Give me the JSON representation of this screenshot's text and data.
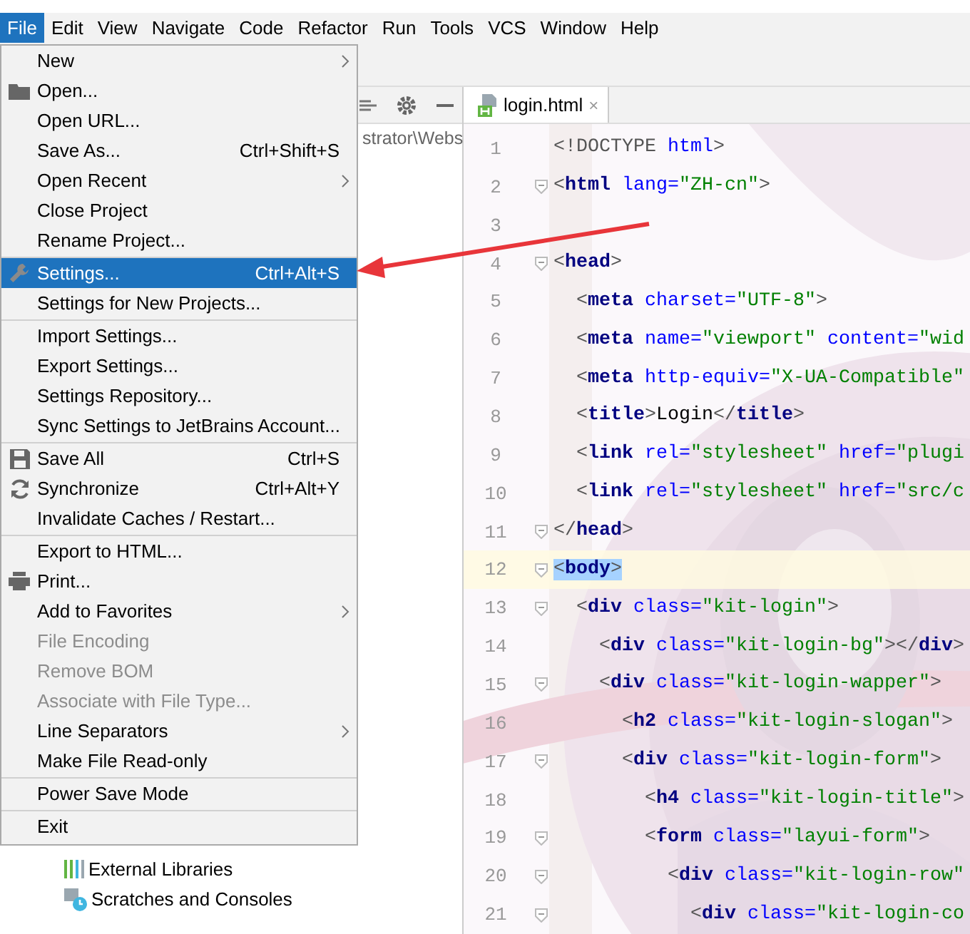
{
  "menu_bar": [
    {
      "label": "File",
      "selected": true
    },
    {
      "label": "Edit",
      "selected": false
    },
    {
      "label": "View",
      "selected": false
    },
    {
      "label": "Navigate",
      "selected": false
    },
    {
      "label": "Code",
      "selected": false
    },
    {
      "label": "Refactor",
      "selected": false
    },
    {
      "label": "Run",
      "selected": false
    },
    {
      "label": "Tools",
      "selected": false
    },
    {
      "label": "VCS",
      "selected": false
    },
    {
      "label": "Window",
      "selected": false
    },
    {
      "label": "Help",
      "selected": false
    }
  ],
  "file_menu": [
    {
      "kind": "item",
      "label": "New",
      "submenu": true,
      "disabled": false,
      "selected": false
    },
    {
      "kind": "folder",
      "label": "Open...",
      "disabled": false,
      "selected": false
    },
    {
      "kind": "item",
      "label": "Open URL...",
      "disabled": false,
      "selected": false
    },
    {
      "kind": "item",
      "label": "Save As...",
      "shortcut": "Ctrl+Shift+S",
      "disabled": false,
      "selected": false
    },
    {
      "kind": "item",
      "label": "Open Recent",
      "submenu": true,
      "disabled": false,
      "selected": false
    },
    {
      "kind": "item",
      "label": "Close Project",
      "disabled": false,
      "selected": false
    },
    {
      "kind": "item",
      "label": "Rename Project...",
      "disabled": false,
      "selected": false
    },
    {
      "kind": "separator"
    },
    {
      "kind": "wrench",
      "label": "Settings...",
      "shortcut": "Ctrl+Alt+S",
      "disabled": false,
      "selected": true
    },
    {
      "kind": "item",
      "label": "Settings for New Projects...",
      "disabled": false,
      "selected": false
    },
    {
      "kind": "separator"
    },
    {
      "kind": "item",
      "label": "Import Settings...",
      "disabled": false,
      "selected": false
    },
    {
      "kind": "item",
      "label": "Export Settings...",
      "disabled": false,
      "selected": false
    },
    {
      "kind": "item",
      "label": "Settings Repository...",
      "disabled": false,
      "selected": false
    },
    {
      "kind": "item",
      "label": "Sync Settings to JetBrains Account...",
      "disabled": false,
      "selected": false
    },
    {
      "kind": "separator"
    },
    {
      "kind": "save",
      "label": "Save All",
      "shortcut": "Ctrl+S",
      "disabled": false,
      "selected": false
    },
    {
      "kind": "sync",
      "label": "Synchronize",
      "shortcut": "Ctrl+Alt+Y",
      "disabled": false,
      "selected": false
    },
    {
      "kind": "item",
      "label": "Invalidate Caches / Restart...",
      "disabled": false,
      "selected": false
    },
    {
      "kind": "separator"
    },
    {
      "kind": "item",
      "label": "Export to HTML...",
      "disabled": false,
      "selected": false
    },
    {
      "kind": "printer",
      "label": "Print...",
      "disabled": false,
      "selected": false
    },
    {
      "kind": "item",
      "label": "Add to Favorites",
      "submenu": true,
      "disabled": false,
      "selected": false
    },
    {
      "kind": "item",
      "label": "File Encoding",
      "disabled": true,
      "selected": false
    },
    {
      "kind": "item",
      "label": "Remove BOM",
      "disabled": true,
      "selected": false
    },
    {
      "kind": "item",
      "label": "Associate with File Type...",
      "disabled": true,
      "selected": false
    },
    {
      "kind": "item",
      "label": "Line Separators",
      "submenu": true,
      "disabled": false,
      "selected": false
    },
    {
      "kind": "item",
      "label": "Make File Read-only",
      "disabled": false,
      "selected": false
    },
    {
      "kind": "separator"
    },
    {
      "kind": "item",
      "label": "Power Save Mode",
      "disabled": false,
      "selected": false
    },
    {
      "kind": "separator"
    },
    {
      "kind": "item",
      "label": "Exit",
      "disabled": false,
      "selected": false
    }
  ],
  "project_panel": {
    "path": "strator\\Webs",
    "tree": [
      {
        "kind": "libraries",
        "label": "External Libraries"
      },
      {
        "kind": "scratches",
        "label": "Scratches and Consoles"
      }
    ]
  },
  "editor": {
    "tabs": [
      {
        "label": "login.html",
        "close": "×",
        "selected": true
      }
    ],
    "lines": [
      {
        "number": "1",
        "fold": false,
        "current": false,
        "tokens": [
          {
            "kind": "punct",
            "text": "<!DOCTYPE "
          },
          {
            "kind": "attr",
            "text": "html"
          },
          {
            "kind": "punct",
            "text": ">"
          }
        ]
      },
      {
        "number": "2",
        "fold": true,
        "current": false,
        "tokens": [
          {
            "kind": "punct",
            "text": "<"
          },
          {
            "kind": "tag",
            "text": "html"
          },
          {
            "kind": "attr",
            "text": " lang="
          },
          {
            "kind": "value",
            "text": "\"ZH-cn\""
          },
          {
            "kind": "punct",
            "text": ">"
          }
        ]
      },
      {
        "number": "3",
        "fold": false,
        "current": false
      },
      {
        "number": "4",
        "fold": true,
        "current": false,
        "tokens": [
          {
            "kind": "punct",
            "text": "<"
          },
          {
            "kind": "tag",
            "text": "head"
          },
          {
            "kind": "punct",
            "text": ">"
          }
        ]
      },
      {
        "number": "5",
        "fold": false,
        "current": false,
        "tokens": [
          {
            "kind": "punct",
            "text": "  <"
          },
          {
            "kind": "tag",
            "text": "meta"
          },
          {
            "kind": "attr",
            "text": " charset="
          },
          {
            "kind": "value",
            "text": "\"UTF-8\""
          },
          {
            "kind": "punct",
            "text": ">"
          }
        ]
      },
      {
        "number": "6",
        "fold": false,
        "current": false,
        "tokens": [
          {
            "kind": "punct",
            "text": "  <"
          },
          {
            "kind": "tag",
            "text": "meta"
          },
          {
            "kind": "attr",
            "text": " name="
          },
          {
            "kind": "value",
            "text": "\"viewport\""
          },
          {
            "kind": "attr",
            "text": " content="
          },
          {
            "kind": "value",
            "text": "\"wid"
          }
        ]
      },
      {
        "number": "7",
        "fold": false,
        "current": false,
        "tokens": [
          {
            "kind": "punct",
            "text": "  <"
          },
          {
            "kind": "tag",
            "text": "meta"
          },
          {
            "kind": "attr",
            "text": " http-equiv="
          },
          {
            "kind": "value",
            "text": "\"X-UA-Compatible\""
          }
        ]
      },
      {
        "number": "8",
        "fold": false,
        "current": false,
        "tokens": [
          {
            "kind": "punct",
            "text": "  <"
          },
          {
            "kind": "tag",
            "text": "title"
          },
          {
            "kind": "punct",
            "text": ">"
          },
          {
            "kind": "text",
            "text": "Login"
          },
          {
            "kind": "punct",
            "text": "</"
          },
          {
            "kind": "tag",
            "text": "title"
          },
          {
            "kind": "punct",
            "text": ">"
          }
        ]
      },
      {
        "number": "9",
        "fold": false,
        "current": false,
        "tokens": [
          {
            "kind": "punct",
            "text": "  <"
          },
          {
            "kind": "tag",
            "text": "link"
          },
          {
            "kind": "attr",
            "text": " rel="
          },
          {
            "kind": "value",
            "text": "\"stylesheet\""
          },
          {
            "kind": "attr",
            "text": " href="
          },
          {
            "kind": "value",
            "text": "\"plugi"
          }
        ]
      },
      {
        "number": "10",
        "fold": false,
        "current": false,
        "tokens": [
          {
            "kind": "punct",
            "text": "  <"
          },
          {
            "kind": "tag",
            "text": "link"
          },
          {
            "kind": "attr",
            "text": " rel="
          },
          {
            "kind": "value",
            "text": "\"stylesheet\""
          },
          {
            "kind": "attr",
            "text": " href="
          },
          {
            "kind": "value",
            "text": "\"src/c"
          }
        ]
      },
      {
        "number": "11",
        "fold": true,
        "current": false,
        "tokens": [
          {
            "kind": "punct",
            "text": "</"
          },
          {
            "kind": "tag",
            "text": "head"
          },
          {
            "kind": "punct",
            "text": ">"
          }
        ]
      },
      {
        "number": "12",
        "fold": true,
        "current": true,
        "tokens": [
          {
            "kind": "punct",
            "text": "<",
            "marked": true
          },
          {
            "kind": "tag",
            "text": "body",
            "marked": true
          },
          {
            "kind": "punct",
            "text": ">",
            "marked": true
          }
        ]
      },
      {
        "number": "13",
        "fold": true,
        "current": false,
        "tokens": [
          {
            "kind": "punct",
            "text": "  <"
          },
          {
            "kind": "tag",
            "text": "div"
          },
          {
            "kind": "attr",
            "text": " class="
          },
          {
            "kind": "value",
            "text": "\"kit-login\""
          },
          {
            "kind": "punct",
            "text": ">"
          }
        ]
      },
      {
        "number": "14",
        "fold": false,
        "current": false,
        "tokens": [
          {
            "kind": "punct",
            "text": "    <"
          },
          {
            "kind": "tag",
            "text": "div"
          },
          {
            "kind": "attr",
            "text": " class="
          },
          {
            "kind": "value",
            "text": "\"kit-login-bg\""
          },
          {
            "kind": "punct",
            "text": "></"
          },
          {
            "kind": "tag",
            "text": "div"
          },
          {
            "kind": "punct",
            "text": ">"
          }
        ]
      },
      {
        "number": "15",
        "fold": true,
        "current": false,
        "tokens": [
          {
            "kind": "punct",
            "text": "    <"
          },
          {
            "kind": "tag",
            "text": "div"
          },
          {
            "kind": "attr",
            "text": " class="
          },
          {
            "kind": "value",
            "text": "\"kit-login-wapper\""
          },
          {
            "kind": "punct",
            "text": ">"
          }
        ]
      },
      {
        "number": "16",
        "fold": false,
        "current": false,
        "tokens": [
          {
            "kind": "punct",
            "text": "      <"
          },
          {
            "kind": "tag",
            "text": "h2"
          },
          {
            "kind": "attr",
            "text": " class="
          },
          {
            "kind": "value",
            "text": "\"kit-login-slogan\""
          },
          {
            "kind": "punct",
            "text": ">"
          }
        ]
      },
      {
        "number": "17",
        "fold": true,
        "current": false,
        "tokens": [
          {
            "kind": "punct",
            "text": "      <"
          },
          {
            "kind": "tag",
            "text": "div"
          },
          {
            "kind": "attr",
            "text": " class="
          },
          {
            "kind": "value",
            "text": "\"kit-login-form\""
          },
          {
            "kind": "punct",
            "text": ">"
          }
        ]
      },
      {
        "number": "18",
        "fold": false,
        "current": false,
        "tokens": [
          {
            "kind": "punct",
            "text": "        <"
          },
          {
            "kind": "tag",
            "text": "h4"
          },
          {
            "kind": "attr",
            "text": " class="
          },
          {
            "kind": "value",
            "text": "\"kit-login-title\""
          },
          {
            "kind": "punct",
            "text": ">"
          }
        ]
      },
      {
        "number": "19",
        "fold": true,
        "current": false,
        "tokens": [
          {
            "kind": "punct",
            "text": "        <"
          },
          {
            "kind": "tag",
            "text": "form"
          },
          {
            "kind": "attr",
            "text": " class="
          },
          {
            "kind": "value",
            "text": "\"layui-form\""
          },
          {
            "kind": "punct",
            "text": ">"
          }
        ]
      },
      {
        "number": "20",
        "fold": true,
        "current": false,
        "tokens": [
          {
            "kind": "punct",
            "text": "          <"
          },
          {
            "kind": "tag",
            "text": "div"
          },
          {
            "kind": "attr",
            "text": " class="
          },
          {
            "kind": "value",
            "text": "\"kit-login-row\""
          }
        ]
      },
      {
        "number": "21",
        "fold": true,
        "current": false,
        "tokens": [
          {
            "kind": "punct",
            "text": "            <"
          },
          {
            "kind": "tag",
            "text": "div"
          },
          {
            "kind": "attr",
            "text": " class="
          },
          {
            "kind": "value",
            "text": "\"kit-login-co"
          }
        ]
      }
    ]
  }
}
